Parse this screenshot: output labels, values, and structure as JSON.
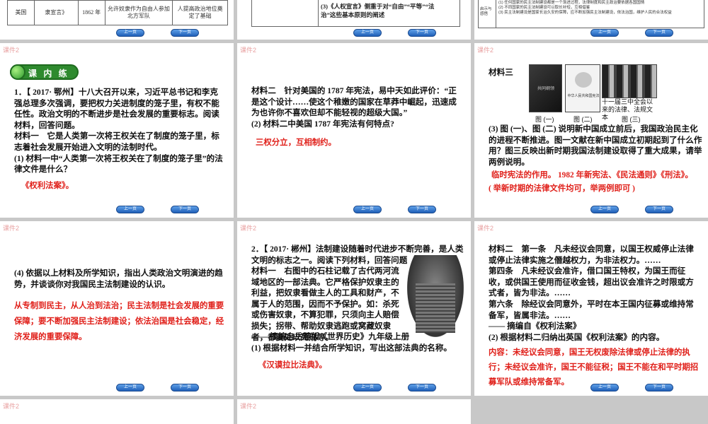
{
  "nav": {
    "prev": "上一页",
    "next": "下一页"
  },
  "tag": "课件2",
  "s0": {
    "row": [
      "美国",
      "隶宣言》",
      "1862 年",
      "允许奴隶作为自由人参加北方军队",
      "人提高政治地位奠定了基础"
    ]
  },
  "s1": {
    "lines": [
      "(3)《人权宣言》侧重于对“自由”“平等”“法",
      "治”这些基本原则的阐述"
    ]
  },
  "s2": {
    "side": "启示与感悟",
    "lines": [
      "(1) 任何国家的民主法制建设都是一个渐进过程，法律制度和民主政治要依据各国国情",
      "(2) 不同国家的民主法制建设可以取长补短，互相借鉴",
      "(3) 民主法制建设是国家长治久安的保障，应不断加强民主法制建设，依法治国，维护人民的合法权益"
    ]
  },
  "s3": {
    "heading": "课 内 练 习",
    "q": "1．【 2017· 鄂州】十八大召开以来，习近平总书记和李克强总理多次强调，要把权力关进制度的笼子里，有权不能任性。政治文明的不断进步是社会发展的重要标志。阅读材料，回答问题。",
    "m1": "材料一　它是人类第一次将王权关在了制度的笼子里，标志着社会发展开始进入文明的法制时代。",
    "q1": "(1) 材料一中“人类第一次将王权关在了制度的笼子里”的法律文件是什么？",
    "a1": "《权利法案》。"
  },
  "s4": {
    "m2": "材料二　针对美国的 1787 年宪法，易中天如此评价：“正是这个设计……使这个稚嫩的国家在草莽中崛起，迅速成为也许你不喜欢但却不能轻视的超级大国。”",
    "q2": "(2) 材料二中美国 1787 年宪法有何特点?",
    "a2": "三权分立，互相制约。"
  },
  "s5": {
    "m3": "材料三",
    "caps": [
      "图 (一)",
      "图 (二)",
      "图 (三)"
    ],
    "cap3": "十一届三中全会以来的法律、法规文本",
    "book1": "共同纲领",
    "book2": "中华人民共和国宪法",
    "q3": "(3) 图 (一)、图 (二) 说明新中国成立前后，我国政治民主化的进程不断推进。图一文献在新中国成立初期起到了什么作用？图三反映出新时期我国法制建设取得了重大成果，请举两例说明。",
    "a3a": "临时宪法的作用。 1982 年新宪法、《民法通则》《刑法》。",
    "a3b": "( 举新时期的法律文件均可，举两例即可 )"
  },
  "s6": {
    "q4": "(4) 依据以上材料及所学知识，指出人类政治文明演进的趋势，并谈谈你对我国民主法制建设的认识。",
    "a4": "从专制到民主，从人治到法治；民主法制是社会发展的重要保障；要不断加强民主法制建设；依法治国是社会稳定，经济发展的重要保障。"
  },
  "s7": {
    "q": "2．【 2017· 郴州】法制建设随着时代进步不断完善，是人类文明的标志之一。阅读下列材料，回答问题。",
    "m1": "材料一　右图中的石柱记载了古代两河流域地区的一部法典。它严格保护奴隶主的利益，把奴隶看做主人的工具和财产，不属于人的范围，因而不予保护。如：杀死或伤害奴隶，不算犯罪，只须向主人赔偿损失；拐带、帮助奴隶逃跑或窝藏奴隶者，都要处以死刑等。",
    "src": "—— 摘编自岳麓版《世界历史》九年级上册",
    "q1": "(1) 根据材料一并结合所学知识，写出这部法典的名称。",
    "a1": "《汉谟拉比法典》。"
  },
  "s8": {
    "m2": "材料二　第一条　凡未经议会同意，以国王权威停止法律或停止法律实施之僭越权力，为非法权力。……",
    "p4": "第四条　凡未经议会准许，借口国王特权，为国王而征收，或供国王使用而征收金钱，超出议会准许之时限或方式者，皆为非法。……",
    "p6": "第六条　除经议会同意外，平时在本王国内征募或维持常备军，皆属非法。……",
    "src": "—— 摘编自《权利法案》",
    "q2": "(2) 根据材料二归纳出英国《权利法案》的内容。",
    "a2": "内容：未经议会同意，国王无权废除法律或停止法律的执行；未经议会准许，国王不能征税；国王不能在和平时期招募军队或维持常备军。"
  }
}
